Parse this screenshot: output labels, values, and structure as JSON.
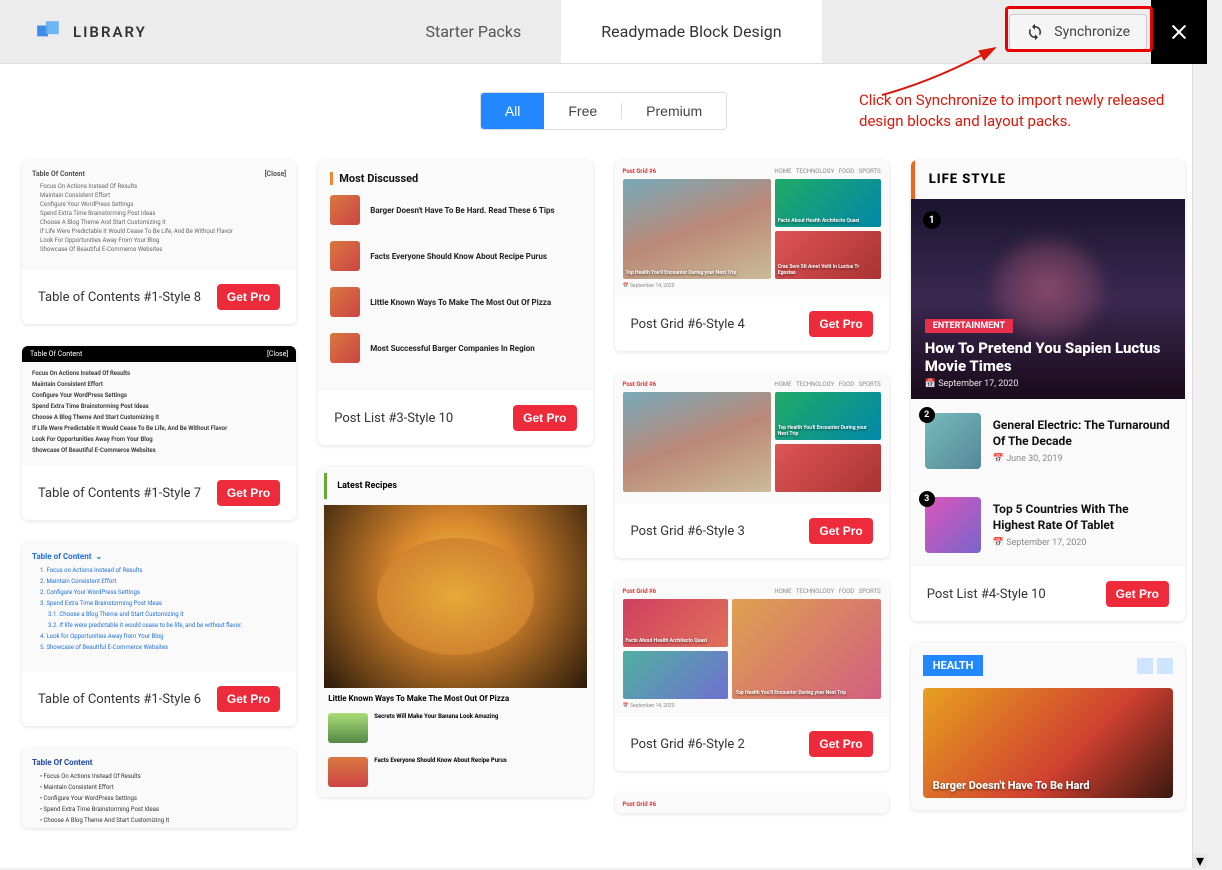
{
  "header": {
    "logo_text": "LIBRARY",
    "tabs": {
      "starter": "Starter Packs",
      "readymade": "Readymade Block Design"
    },
    "sync_label": "Synchronize"
  },
  "annotation": {
    "text": "Click on Synchronize to import newly released design blocks and layout packs."
  },
  "filters": {
    "all": "All",
    "free": "Free",
    "premium": "Premium"
  },
  "getpro": "Get Pro",
  "col1": {
    "c1": "Table of Contents #1-Style 8",
    "c2": "Table of Contents #1-Style 7",
    "c3": "Table of Contents #1-Style 6",
    "toc_head": "Table Of Content",
    "toc_close": "[Close]",
    "toc_lines": [
      "Focus On Actions Instead Of Results",
      "Maintain Consistent Effort",
      "Configure Your WordPress Settings",
      "Spend Extra Time Brainstorming Post Ideas",
      "Choose A Blog Theme And Start Customizing It",
      "If Life Were Predictable It Would Cease To Be Life, And Be Without Flavor",
      "Look For Opportunities Away From Your Blog",
      "Showcase Of Beautiful E-Commerce Websites"
    ],
    "toc3_head": "Table of Content",
    "toc3_lines": [
      "1. Focus on Actions Instead of Results",
      "2. Maintain Consistent Effort",
      "2. Configure Your WordPress Settings",
      "3. Spend Extra Time Brainstorming Post Ideas",
      "3.1. Choose a Blog Theme and Start Customizing It",
      "3.2. If life were predictable it would cease to be life, and be without flavor.",
      "4. Look for Opportunities Away from Your Blog",
      "5. Showcase of Beautiful E-Commerce Websites"
    ],
    "toc4_head": "Table Of Content",
    "toc4_lines": [
      "Focus On Actions Instead Of Results",
      "Maintain Consistent Effort",
      "Configure Your WordPress Settings",
      "Spend Extra Time Brainstorming Post Ideas",
      "Choose A Blog Theme And Start Customizing It"
    ]
  },
  "col2": {
    "c1": "Post List #3-Style 10",
    "pl_title": "Most Discussed",
    "pl_items": [
      "Barger Doesn't Have To Be Hard. Read These 6 Tips",
      "Facts Everyone Should Know About Recipe Purus",
      "Little Known Ways To Make The Most Out Of Pizza",
      "Most Successful Barger Companies In Region"
    ],
    "bp_head": "Latest Recipes",
    "bp_caption": "Little Known Ways To Make The Most Out Of Pizza",
    "bp_sub1": "Secrets Will Make Your Banana Look Amazing",
    "bp_sub2": "Facts Everyone Should Know About Recipe Purus"
  },
  "col3": {
    "c1": "Post Grid #6-Style 4",
    "c2": "Post Grid #6-Style 3",
    "c3": "Post Grid #6-Style 2",
    "pg_brand": "Post Grid #6",
    "pg_labels": {
      "a": "Facts About Health Architecto Quasi",
      "b": "Cras Sem Sit Amet Velit In Luctus Tr Egestas",
      "c": "Top Health You'll Encounter During your Next Trip"
    }
  },
  "col4": {
    "c1": "Post List #4-Style 10",
    "ls_head": "LIFE STYLE",
    "ls_tag": "ENTERTAINMENT",
    "ls_title": "How To Pretend You Sapien Luctus Movie Times",
    "ls_date": "📅 September 17, 2020",
    "items": [
      {
        "t": "General Electric: The Turnaround Of The Decade",
        "d": "📅 June 30, 2019"
      },
      {
        "t": "Top 5 Countries With The Highest Rate Of Tablet",
        "d": "📅 September 17, 2020"
      }
    ],
    "health_head": "HEALTH",
    "health_cap": "Barger Doesn't Have To Be Hard"
  }
}
